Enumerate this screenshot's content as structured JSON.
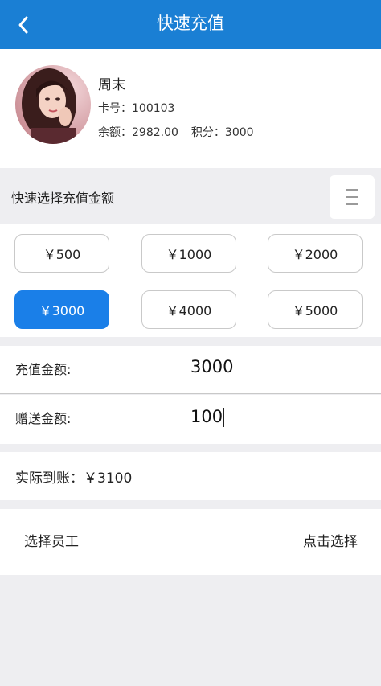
{
  "header": {
    "title": "快速充值",
    "back_icon": "chevron-left-icon",
    "bg_color": "#1a7fd4"
  },
  "member": {
    "name": "周末",
    "card_label": "卡号：",
    "card_no": "100103",
    "balance_label": "余额：",
    "balance": "2982.00",
    "points_label": "积分：",
    "points": "3000"
  },
  "quick_select": {
    "title": "快速选择充值金额",
    "menu_icon": "menu-icon"
  },
  "amounts": [
    {
      "label": "￥500",
      "selected": false
    },
    {
      "label": "￥1000",
      "selected": false
    },
    {
      "label": "￥2000",
      "selected": false
    },
    {
      "label": "￥3000",
      "selected": true
    },
    {
      "label": "￥4000",
      "selected": false
    },
    {
      "label": "￥5000",
      "selected": false
    }
  ],
  "form": {
    "recharge_label": "充值金额:",
    "recharge_value": "3000",
    "bonus_label": "赠送金额:",
    "bonus_value": "100"
  },
  "actual": {
    "text": "实际到账：￥3100"
  },
  "staff": {
    "label": "选择员工",
    "action": "点击选择"
  },
  "colors": {
    "accent": "#1a7fe8",
    "page_bg": "#eeeef1"
  }
}
